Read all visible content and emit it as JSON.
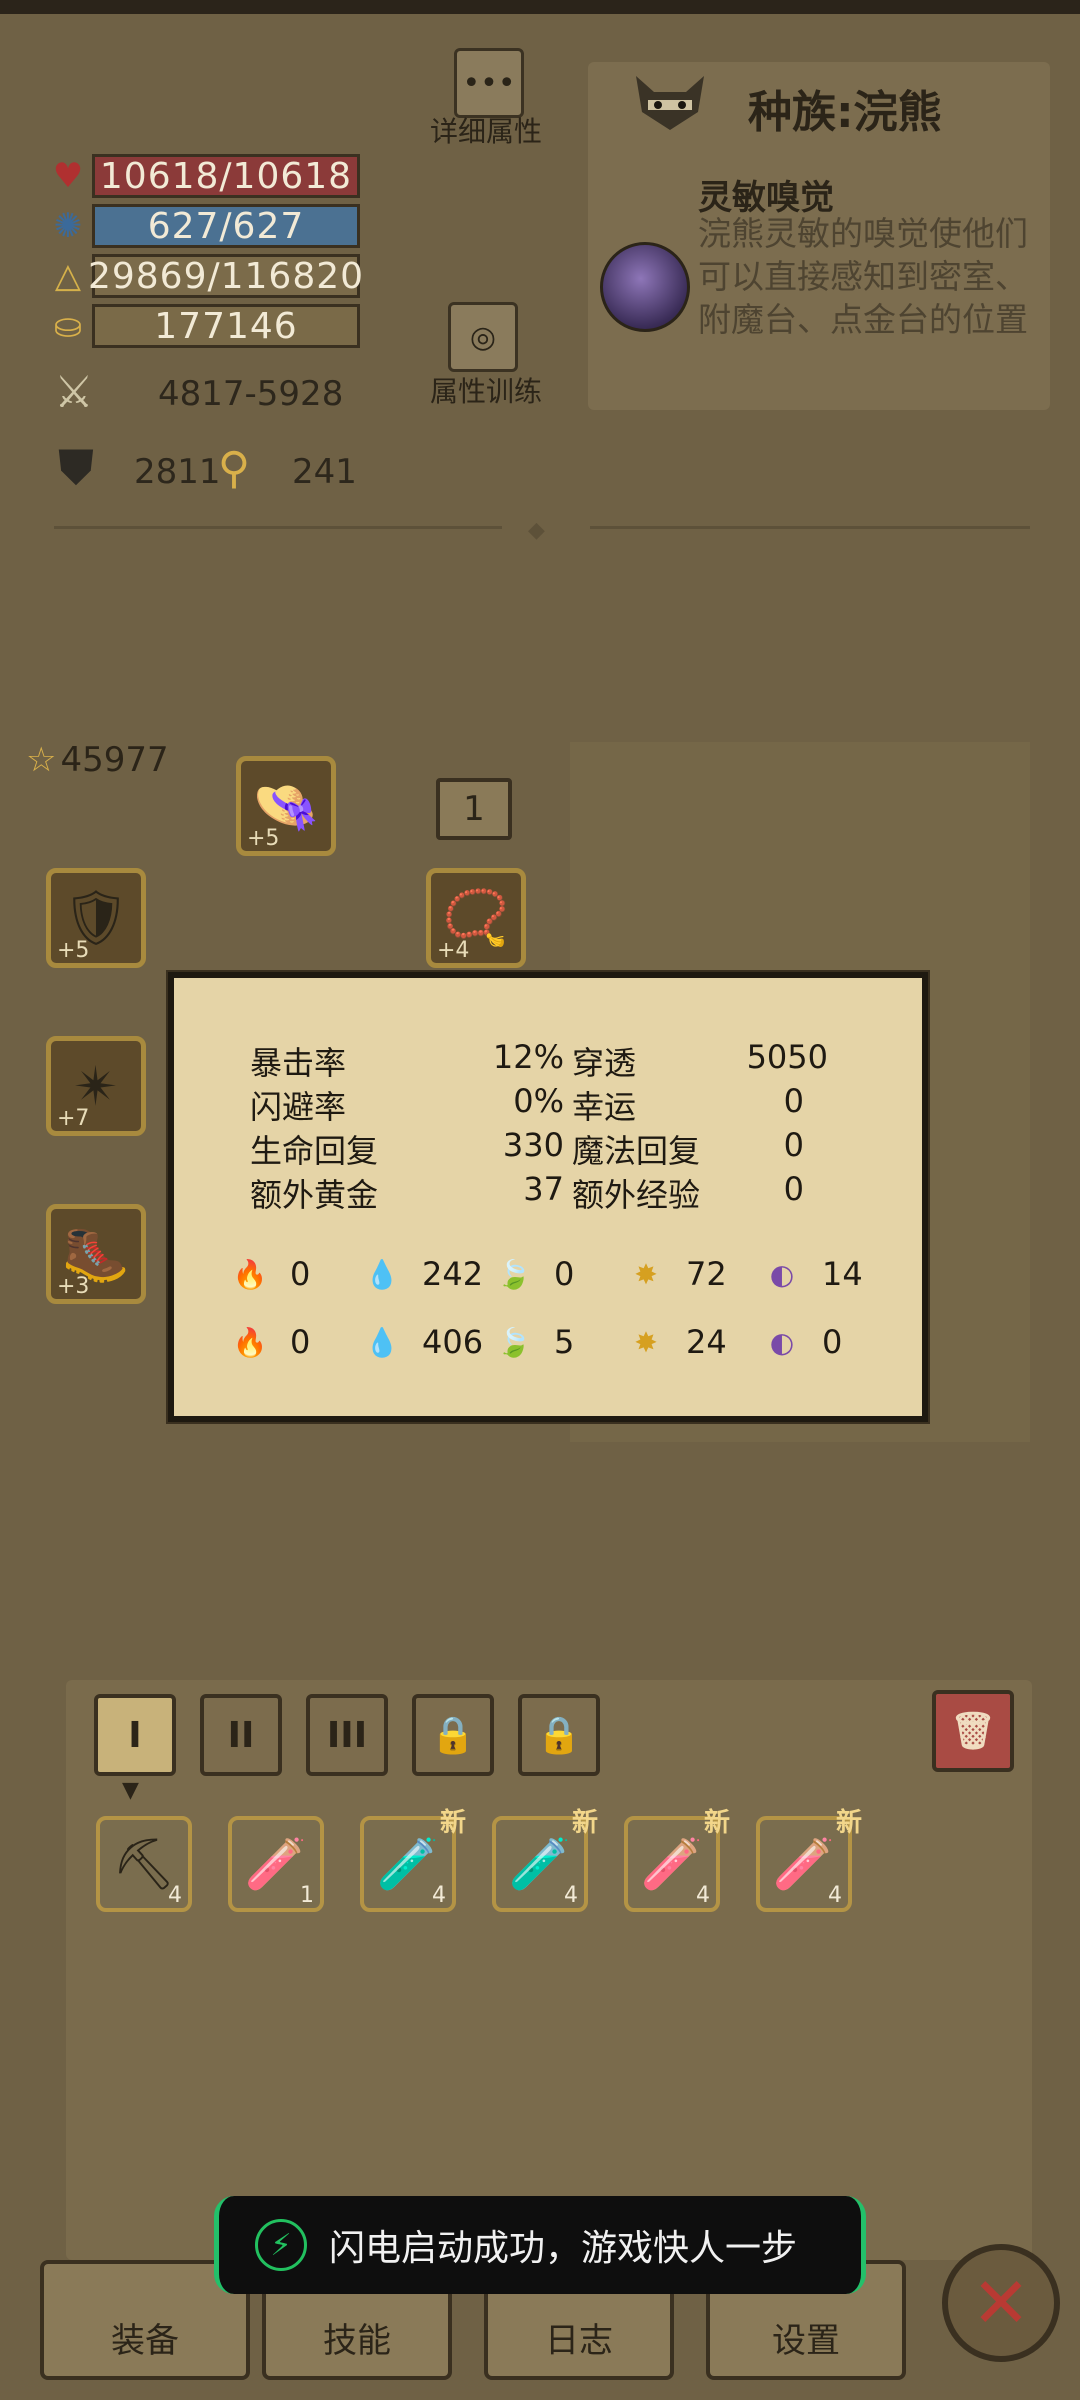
{
  "stats": {
    "hp": "10618/10618",
    "mp": "627/627",
    "exp": "29869/116820",
    "gold": "177146",
    "attack": "4817-5928",
    "armor": "2811",
    "keys": "241"
  },
  "buttons": {
    "detail_attrs": "详细属性",
    "attr_training": "属性训练"
  },
  "race": {
    "title": "种族:浣熊",
    "skill_name": "灵敏嗅觉",
    "skill_desc": "浣熊灵敏的嗅觉使他们可以直接感知到密室、附魔台、点金台的位置"
  },
  "equipment": {
    "score": "45977",
    "slot_count": "1",
    "slots": [
      {
        "name": "hat",
        "level": "+5"
      },
      {
        "name": "shield",
        "level": "+5"
      },
      {
        "name": "amulet",
        "level": "+4"
      },
      {
        "name": "armor",
        "level": "+7"
      },
      {
        "name": "boots",
        "level": "+3"
      }
    ]
  },
  "tooltip": {
    "rows": [
      {
        "l_label": "暴击率",
        "l_val": "12%",
        "r_label": "穿透",
        "r_val": "5050"
      },
      {
        "l_label": "闪避率",
        "l_val": "0%",
        "r_label": "幸运",
        "r_val": "0"
      },
      {
        "l_label": "生命回复",
        "l_val": "330",
        "r_label": "魔法回复",
        "r_val": "0"
      },
      {
        "l_label": "额外黄金",
        "l_val": "37",
        "r_label": "额外经验",
        "r_val": "0"
      }
    ],
    "attack_elements": [
      "0",
      "242",
      "0",
      "72",
      "14"
    ],
    "resist_elements": [
      "0",
      "406",
      "5",
      "24",
      "0"
    ],
    "element_colors": [
      "#c43a2a",
      "#3f86b8",
      "#5f8a3a",
      "#d6a020",
      "#7a4aa8"
    ]
  },
  "inventory": {
    "tabs": [
      "I",
      "II",
      "III",
      "🔒",
      "🔒"
    ],
    "items": [
      {
        "icon": "pickaxe-icon",
        "glyph": "⛏",
        "count": "4",
        "new": ""
      },
      {
        "icon": "blue-potion-icon",
        "glyph": "🧪",
        "count": "1",
        "new": ""
      },
      {
        "icon": "red-potion-icon",
        "glyph": "🧪",
        "count": "4",
        "new": "新"
      },
      {
        "icon": "red-potion-icon",
        "glyph": "🧪",
        "count": "4",
        "new": "新"
      },
      {
        "icon": "blue-potion-icon",
        "glyph": "🧪",
        "count": "4",
        "new": "新"
      },
      {
        "icon": "blue-potion-icon",
        "glyph": "🧪",
        "count": "4",
        "new": "新"
      }
    ]
  },
  "toast": "闪电启动成功，游戏快人一步",
  "nav": [
    "装备",
    "技能",
    "日志",
    "设置"
  ]
}
